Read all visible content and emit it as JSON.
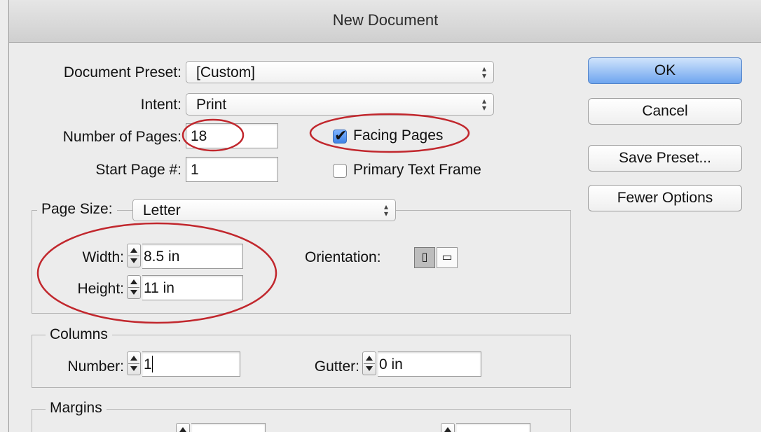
{
  "window": {
    "title": "New Document"
  },
  "form": {
    "document_preset_label": "Document Preset:",
    "document_preset_value": "[Custom]",
    "intent_label": "Intent:",
    "intent_value": "Print",
    "num_pages_label": "Number of Pages:",
    "num_pages_value": "18",
    "start_page_label": "Start Page #:",
    "start_page_value": "1",
    "facing_pages_label": "Facing Pages",
    "facing_pages_checked": true,
    "primary_text_frame_label": "Primary Text Frame",
    "primary_text_frame_checked": false
  },
  "page_size": {
    "label": "Page Size:",
    "value": "Letter",
    "width_label": "Width:",
    "width_value": "8.5 in",
    "height_label": "Height:",
    "height_value": "11 in",
    "orientation_label": "Orientation:",
    "orientation_options": [
      "portrait",
      "landscape"
    ],
    "orientation_selected": "portrait"
  },
  "columns": {
    "legend": "Columns",
    "number_label": "Number:",
    "number_value": "1",
    "gutter_label": "Gutter:",
    "gutter_value": "0 in"
  },
  "margins": {
    "legend": "Margins"
  },
  "buttons": {
    "ok": "OK",
    "cancel": "Cancel",
    "save_preset": "Save Preset...",
    "fewer_options": "Fewer Options"
  },
  "icons": {
    "select_arrows": "up-down-arrows-icon",
    "spinner": "stepper-icon",
    "orientation_portrait": "portrait-orientation-icon",
    "orientation_landscape": "landscape-orientation-icon"
  },
  "colors": {
    "default_button": "#6ea5ef",
    "annotation_circle": "#c1272d"
  }
}
